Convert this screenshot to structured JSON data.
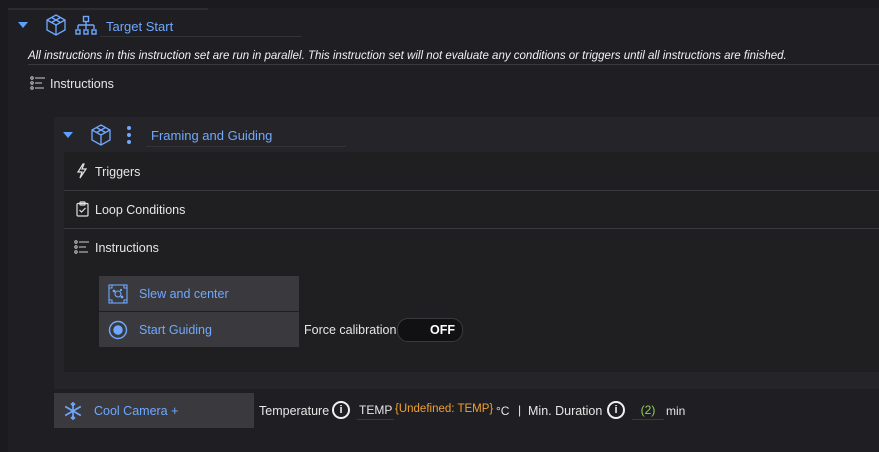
{
  "target": {
    "title": "Target Start",
    "note": "All instructions in this instruction set are run in parallel. This instruction set will not evaluate any conditions or triggers until all instructions are finished.",
    "instructions_label": "Instructions"
  },
  "framing": {
    "title": "Framing and Guiding",
    "triggers_label": "Triggers",
    "loop_conditions_label": "Loop Conditions",
    "instructions_label": "Instructions",
    "items": [
      {
        "label": "Slew and center",
        "icon": "target-grid-icon"
      },
      {
        "label": "Start Guiding",
        "icon": "guiding-icon"
      }
    ],
    "force_calibration": {
      "label": "Force calibration",
      "value": "OFF"
    }
  },
  "cool_camera": {
    "label": "Cool Camera +",
    "temperature_label": "Temperature",
    "temp_field": "TEMP",
    "temp_undefined": "{Undefined: TEMP}",
    "temp_unit": "°C",
    "separator": "|",
    "min_duration_label": "Min. Duration",
    "duration_value": "(2)",
    "duration_unit": "min"
  },
  "colors": {
    "accent": "#6fa8ff",
    "warning": "#f0a030",
    "ok": "#8fd05a",
    "background": "#1b1b1f"
  }
}
